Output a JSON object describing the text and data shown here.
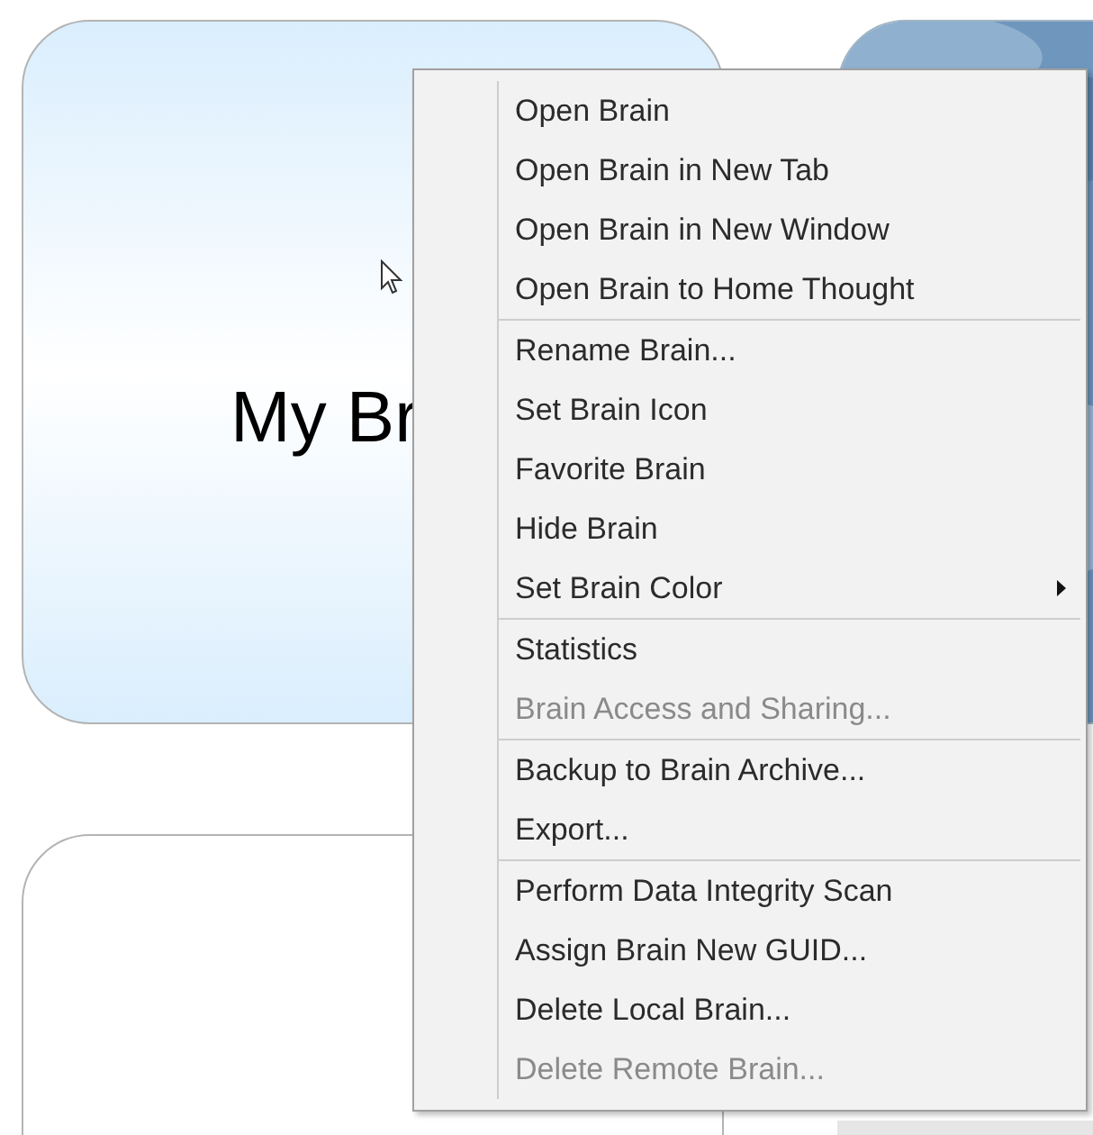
{
  "cards": [
    {
      "kind": "gradient",
      "title": "My Br"
    },
    {
      "kind": "picture"
    },
    {
      "kind": "plain"
    },
    {
      "kind": "shaded"
    }
  ],
  "context_menu": {
    "items": [
      {
        "label": "Open Brain",
        "disabled": false,
        "separator_before": false,
        "submenu": false
      },
      {
        "label": "Open Brain in New Tab",
        "disabled": false,
        "separator_before": false,
        "submenu": false
      },
      {
        "label": "Open Brain in New Window",
        "disabled": false,
        "separator_before": false,
        "submenu": false
      },
      {
        "label": "Open Brain to Home Thought",
        "disabled": false,
        "separator_before": false,
        "submenu": false
      },
      {
        "label": "Rename Brain...",
        "disabled": false,
        "separator_before": true,
        "submenu": false
      },
      {
        "label": "Set Brain Icon",
        "disabled": false,
        "separator_before": false,
        "submenu": false
      },
      {
        "label": "Favorite Brain",
        "disabled": false,
        "separator_before": false,
        "submenu": false
      },
      {
        "label": "Hide Brain",
        "disabled": false,
        "separator_before": false,
        "submenu": false
      },
      {
        "label": "Set Brain Color",
        "disabled": false,
        "separator_before": false,
        "submenu": true
      },
      {
        "label": "Statistics",
        "disabled": false,
        "separator_before": true,
        "submenu": false
      },
      {
        "label": "Brain Access and Sharing...",
        "disabled": true,
        "separator_before": false,
        "submenu": false
      },
      {
        "label": "Backup to Brain Archive...",
        "disabled": false,
        "separator_before": true,
        "submenu": false
      },
      {
        "label": "Export...",
        "disabled": false,
        "separator_before": false,
        "submenu": false
      },
      {
        "label": "Perform Data Integrity Scan",
        "disabled": false,
        "separator_before": true,
        "submenu": false
      },
      {
        "label": "Assign Brain New GUID...",
        "disabled": false,
        "separator_before": false,
        "submenu": false
      },
      {
        "label": "Delete Local Brain...",
        "disabled": false,
        "separator_before": false,
        "submenu": false
      },
      {
        "label": "Delete Remote Brain...",
        "disabled": true,
        "separator_before": false,
        "submenu": false
      }
    ]
  }
}
